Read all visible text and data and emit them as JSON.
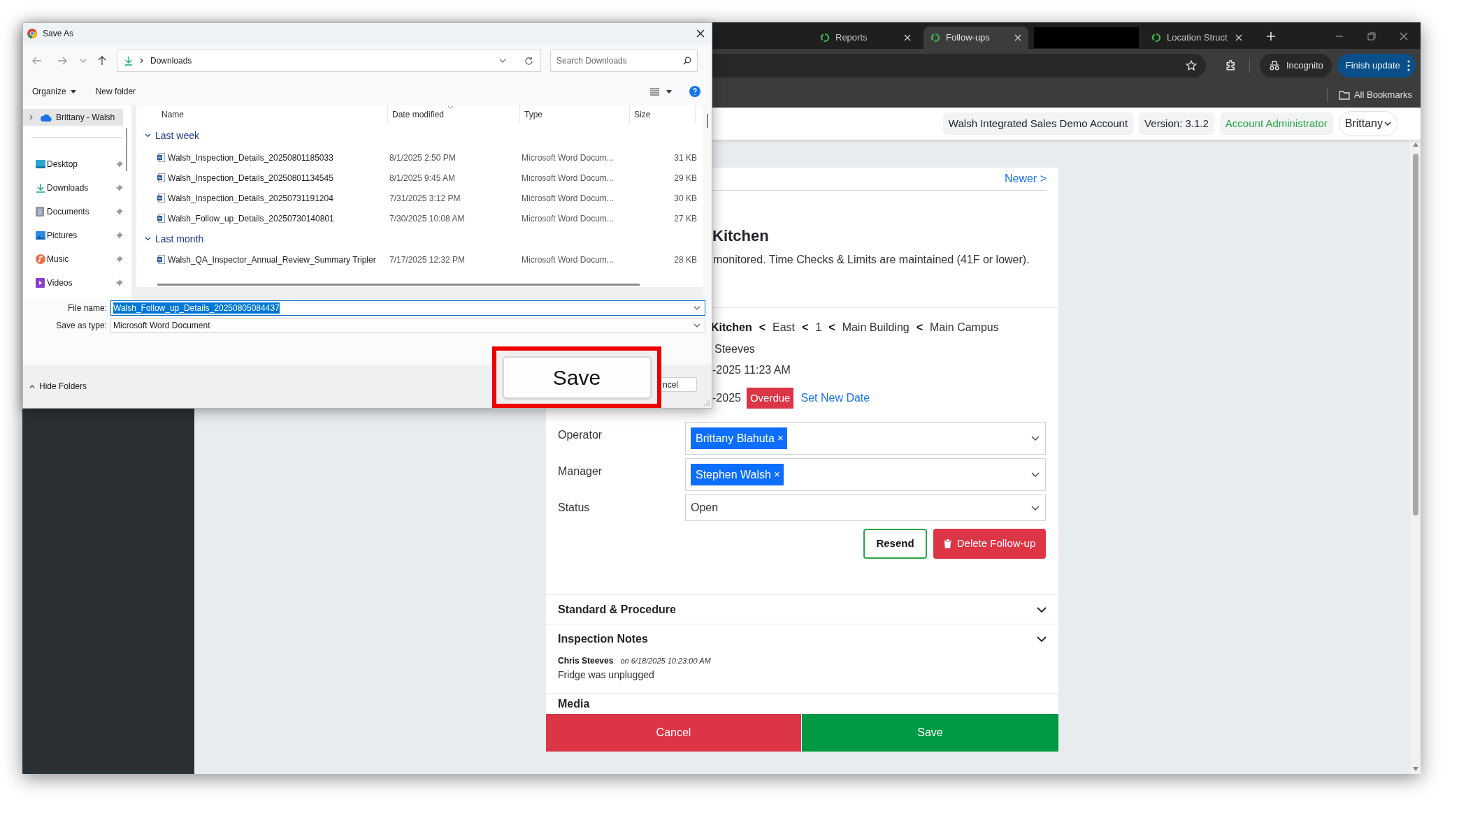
{
  "browser": {
    "tabs": [
      {
        "kind": "page",
        "title": "Reports",
        "selected": false
      },
      {
        "kind": "page",
        "title": "Follow-ups",
        "selected": true
      },
      {
        "kind": "redacted",
        "selected": false
      },
      {
        "kind": "page",
        "title": "Location Struct",
        "selected": false
      }
    ],
    "incognito": "Incognito",
    "update_button": "Finish update",
    "bookmarks_folder": "All Bookmarks"
  },
  "app": {
    "header": {
      "account": "Walsh Integrated Sales Demo Account",
      "version": "Version: 3.1.2",
      "role": "Account Administrator",
      "user": "Brittany"
    },
    "newer_link": "Newer >",
    "title": "Kitchen",
    "description": "monitored. Time Checks & Limits are maintained (41F or lower).",
    "location_path": [
      {
        "kind": "current",
        "text": "Kitchen"
      },
      {
        "kind": "separator",
        "text": "<"
      },
      {
        "kind": "place",
        "text": "East"
      },
      {
        "kind": "separator",
        "text": "<"
      },
      {
        "kind": "place",
        "text": "1"
      },
      {
        "kind": "separator",
        "text": "<"
      },
      {
        "kind": "place",
        "text": "Main Building"
      },
      {
        "kind": "separator",
        "text": "<"
      },
      {
        "kind": "place",
        "text": "Main Campus"
      }
    ],
    "inspector": "Steeves",
    "inspected_at": "-2025 11:23 AM",
    "due_date": "-2025",
    "due_badge": "Overdue",
    "set_date_link": "Set New Date",
    "fields": [
      {
        "kind": "tags",
        "label": "Operator",
        "tags": [
          {
            "name": "Brittany Blahuta",
            "remove": "×"
          }
        ]
      },
      {
        "kind": "tags",
        "label": "Manager",
        "tags": [
          {
            "name": "Stephen Walsh",
            "remove": "×"
          }
        ]
      },
      {
        "kind": "select",
        "label": "Status",
        "value": "Open"
      }
    ],
    "buttons": {
      "resend": "Resend",
      "delete": "Delete Follow-up"
    },
    "sections": [
      {
        "title": "Standard & Procedure"
      },
      {
        "title": "Inspection Notes",
        "notes": [
          {
            "author": "Chris Steeves",
            "timestamp": "on 6/18/2025 10:23:00 AM",
            "text": "Fridge was unplugged"
          }
        ]
      }
    ],
    "media_heading": "Media",
    "footer": {
      "cancel": "Cancel",
      "save": "Save"
    }
  },
  "dialog": {
    "title": "Save As",
    "location": "Downloads",
    "search_placeholder": "Search Downloads",
    "organize": "Organize",
    "new_folder": "New folder",
    "nav": [
      {
        "kind": "cloud",
        "label": "Brittany - Walsh",
        "selected": true,
        "pinned": false
      },
      {
        "kind": "desktop",
        "label": "Desktop",
        "selected": false,
        "pinned": true
      },
      {
        "kind": "downloads",
        "label": "Downloads",
        "selected": false,
        "pinned": true
      },
      {
        "kind": "documents",
        "label": "Documents",
        "selected": false,
        "pinned": true
      },
      {
        "kind": "pictures",
        "label": "Pictures",
        "selected": false,
        "pinned": true
      },
      {
        "kind": "music",
        "label": "Music",
        "selected": false,
        "pinned": true
      },
      {
        "kind": "videos",
        "label": "Videos",
        "selected": false,
        "pinned": true
      }
    ],
    "columns": [
      "Name",
      "Date modified",
      "Type",
      "Size"
    ],
    "groups": [
      {
        "title": "Last week",
        "files": [
          {
            "name": "Walsh_Inspection_Details_20250801185033",
            "date": "8/1/2025 2:50 PM",
            "type": "Microsoft Word Docum...",
            "size": "31 KB"
          },
          {
            "name": "Walsh_Inspection_Details_20250801134545",
            "date": "8/1/2025 9:45 AM",
            "type": "Microsoft Word Docum...",
            "size": "29 KB"
          },
          {
            "name": "Walsh_Inspection_Details_20250731191204",
            "date": "7/31/2025 3:12 PM",
            "type": "Microsoft Word Docum...",
            "size": "30 KB"
          },
          {
            "name": "Walsh_Follow_up_Details_20250730140801",
            "date": "7/30/2025 10:08 AM",
            "type": "Microsoft Word Docum...",
            "size": "27 KB"
          }
        ]
      },
      {
        "title": "Last month",
        "files": [
          {
            "name": "Walsh_QA_Inspector_Annual_Review_Summary Tripler",
            "date": "7/17/2025 12:32 PM",
            "type": "Microsoft Word Docum...",
            "size": "28 KB"
          }
        ]
      }
    ],
    "file_name_label": "File name:",
    "file_name": "Walsh_Follow_up_Details_20250805084437",
    "type_label": "Save as type:",
    "save_type": "Microsoft Word Document",
    "hide_folders": "Hide Folders",
    "save_button": "Save",
    "cancel_button": "ncel"
  }
}
